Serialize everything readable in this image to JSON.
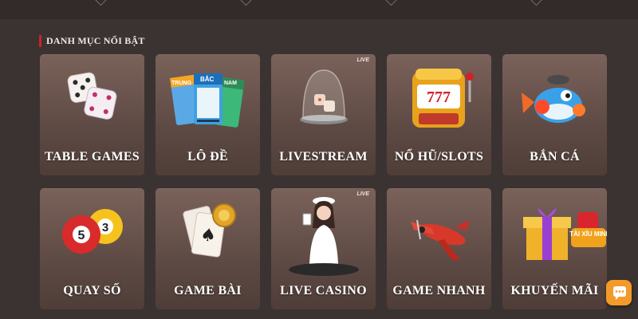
{
  "section": {
    "title": "DANH MỤC NỔI BẬT"
  },
  "tiles": [
    {
      "label": "TABLE GAMES",
      "icon": "dice-icon"
    },
    {
      "label": "LÔ ĐỀ",
      "icon": "lottery-tickets-icon",
      "ticket_labels": [
        "TRUNG",
        "BẮC",
        "NAM"
      ]
    },
    {
      "label": "LIVESTREAM",
      "icon": "dice-dome-icon",
      "badge": "LIVE"
    },
    {
      "label": "NỔ HŨ/SLOTS",
      "icon": "slot-machine-icon",
      "art_text": "777"
    },
    {
      "label": "BẮN CÁ",
      "icon": "fish-icon"
    },
    {
      "label": "QUAY SỐ",
      "icon": "lottery-balls-icon",
      "ball_numbers": [
        "5",
        "3"
      ]
    },
    {
      "label": "GAME BÀI",
      "icon": "playing-cards-icon"
    },
    {
      "label": "LIVE CASINO",
      "icon": "casino-dealer-icon",
      "badge": "LIVE"
    },
    {
      "label": "GAME NHANH",
      "icon": "airplane-icon"
    },
    {
      "label": "KHUYẾN MÃI",
      "icon": "gift-box-icon",
      "promo_logo": "TÀI XỈU MINI"
    }
  ],
  "colors": {
    "accent": "#c8262b",
    "background": "#3b3331",
    "chat": "#f39a2a"
  },
  "chat": {
    "icon": "chat-icon"
  }
}
